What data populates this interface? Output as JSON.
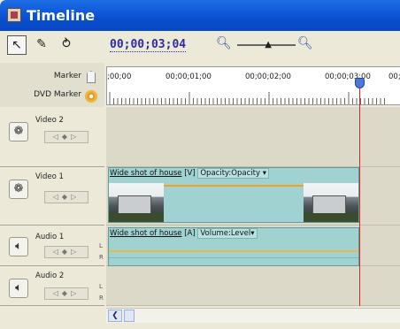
{
  "window": {
    "title": "Timeline"
  },
  "toolbar": {
    "timecode": "00;00;03;04",
    "zoom_level": 0.55
  },
  "ruler": {
    "marker_label": "Marker",
    "dvd_marker_label": "DVD Marker",
    "time_labels": [
      ";00;00",
      "00;00;01;00",
      "00;00;02;00",
      "00;00;03;00",
      "00;0"
    ]
  },
  "tracks": [
    {
      "name": "Video 2",
      "type": "video"
    },
    {
      "name": "Video 1",
      "type": "video"
    },
    {
      "name": "Audio 1",
      "type": "audio",
      "channels": [
        "L",
        "R"
      ]
    },
    {
      "name": "Audio 2",
      "type": "audio",
      "channels": [
        "L",
        "R"
      ]
    }
  ],
  "clips": {
    "video": {
      "name": "Wide shot of house",
      "tag": "[V]",
      "effect": "Opacity:Opacity"
    },
    "audio": {
      "name": "Wide shot of house",
      "tag": "[A]",
      "effect": "Volume:Level"
    }
  }
}
